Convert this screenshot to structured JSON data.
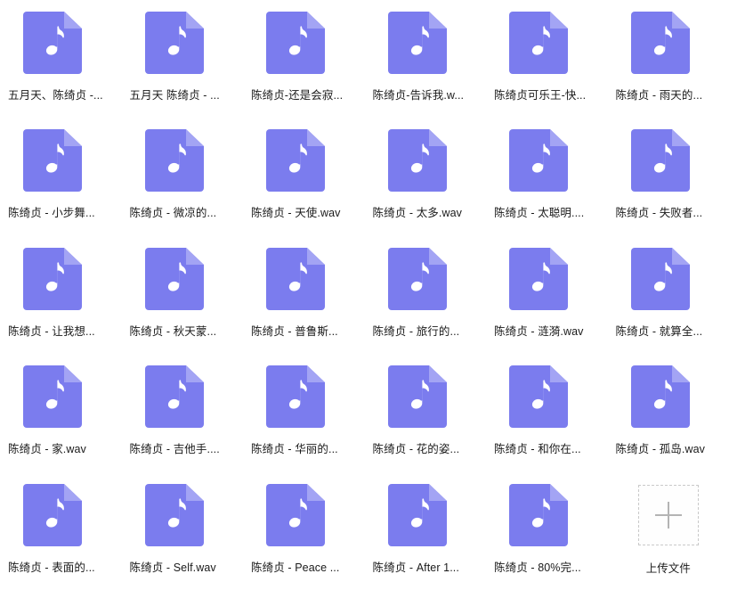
{
  "theme": {
    "icon_body_color": "#7b7cee",
    "icon_fold_color": "#a3a4f4",
    "note_color": "#ffffff",
    "label_color": "#1a1a1a",
    "upload_border_color": "#c9c9c9",
    "plus_color": "#b4b4b4",
    "background": "#ffffff"
  },
  "grid": {
    "columns": 6,
    "rows": 5,
    "icon_name": "music-file-icon"
  },
  "files": [
    {
      "label": "五月天、陈绮贞 -..."
    },
    {
      "label": "五月天 陈绮贞 - ..."
    },
    {
      "label": "陈绮贞-还是会寂..."
    },
    {
      "label": "陈绮贞-告诉我.w..."
    },
    {
      "label": "陈绮贞可乐王-快..."
    },
    {
      "label": "陈绮贞 - 雨天的..."
    },
    {
      "label": "陈绮贞 - 小步舞..."
    },
    {
      "label": "陈绮贞 - 微凉的..."
    },
    {
      "label": "陈绮贞 - 天使.wav"
    },
    {
      "label": "陈绮贞 - 太多.wav"
    },
    {
      "label": "陈绮贞 - 太聪明...."
    },
    {
      "label": "陈绮贞 - 失败者..."
    },
    {
      "label": "陈绮贞 - 让我想..."
    },
    {
      "label": "陈绮贞 - 秋天蒙..."
    },
    {
      "label": "陈绮贞 - 普鲁斯..."
    },
    {
      "label": "陈绮贞 - 旅行的..."
    },
    {
      "label": "陈绮贞 - 涟漪.wav"
    },
    {
      "label": "陈绮贞 - 就算全..."
    },
    {
      "label": "陈绮贞 - 家.wav"
    },
    {
      "label": "陈绮贞 - 吉他手...."
    },
    {
      "label": "陈绮贞 - 华丽的..."
    },
    {
      "label": "陈绮贞 - 花的姿..."
    },
    {
      "label": "陈绮贞 - 和你在..."
    },
    {
      "label": "陈绮贞 - 孤岛.wav"
    },
    {
      "label": "陈绮贞 - 表面的..."
    },
    {
      "label": "陈绮贞 - Self.wav"
    },
    {
      "label": "陈绮贞 - Peace ..."
    },
    {
      "label": "陈绮贞 - After 1..."
    },
    {
      "label": "陈绮贞 - 80%完..."
    }
  ],
  "upload": {
    "label": "上传文件",
    "icon_name": "plus-icon"
  }
}
